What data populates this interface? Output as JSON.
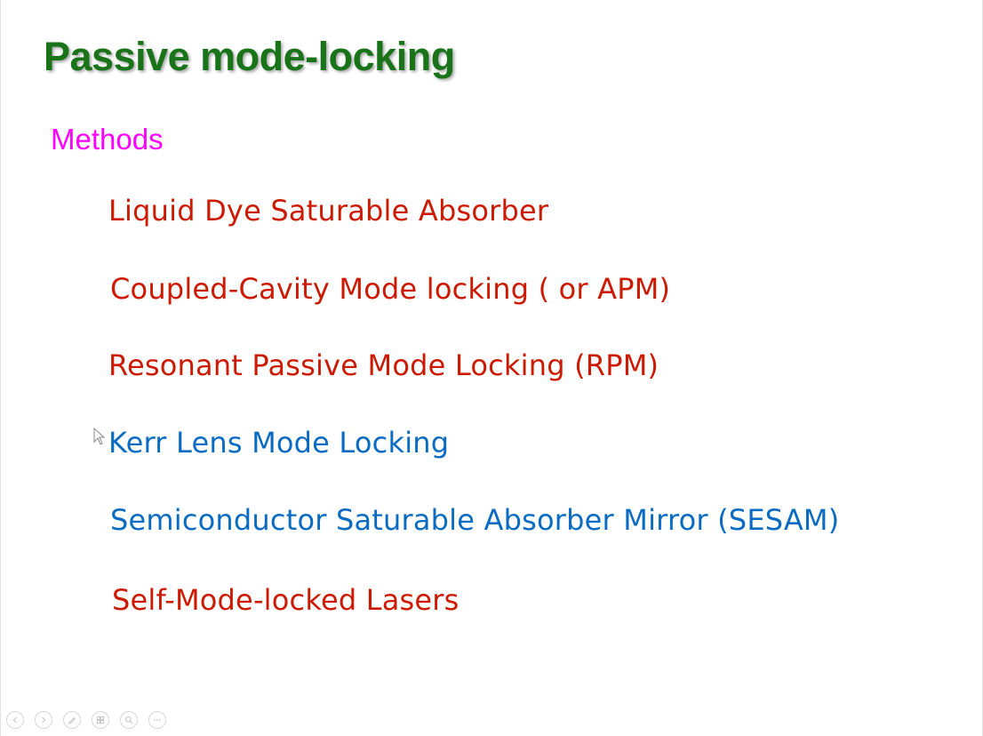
{
  "slide": {
    "title": "Passive mode-locking",
    "subtitle": "Methods",
    "methods": [
      {
        "label": "Liquid Dye Saturable Absorber",
        "color": "#cc1a00"
      },
      {
        "label": "Coupled-Cavity Mode locking ( or APM)",
        "color": "#cc1a00"
      },
      {
        "label": "Resonant Passive Mode Locking (RPM)",
        "color": "#cc1a00"
      },
      {
        "label": "Kerr Lens Mode Locking",
        "color": "#0a6bc2"
      },
      {
        "label": "Semiconductor Saturable Absorber Mirror (SESAM)",
        "color": "#0a6bc2"
      },
      {
        "label": "Self-Mode-locked Lasers",
        "color": "#cc1a00"
      }
    ]
  },
  "colors": {
    "title": "#197319",
    "subtitle": "#ff00ff"
  },
  "controls": [
    {
      "icon": "previous-icon"
    },
    {
      "icon": "next-icon"
    },
    {
      "icon": "pen-icon"
    },
    {
      "icon": "slides-icon"
    },
    {
      "icon": "zoom-icon"
    },
    {
      "icon": "more-icon"
    }
  ]
}
